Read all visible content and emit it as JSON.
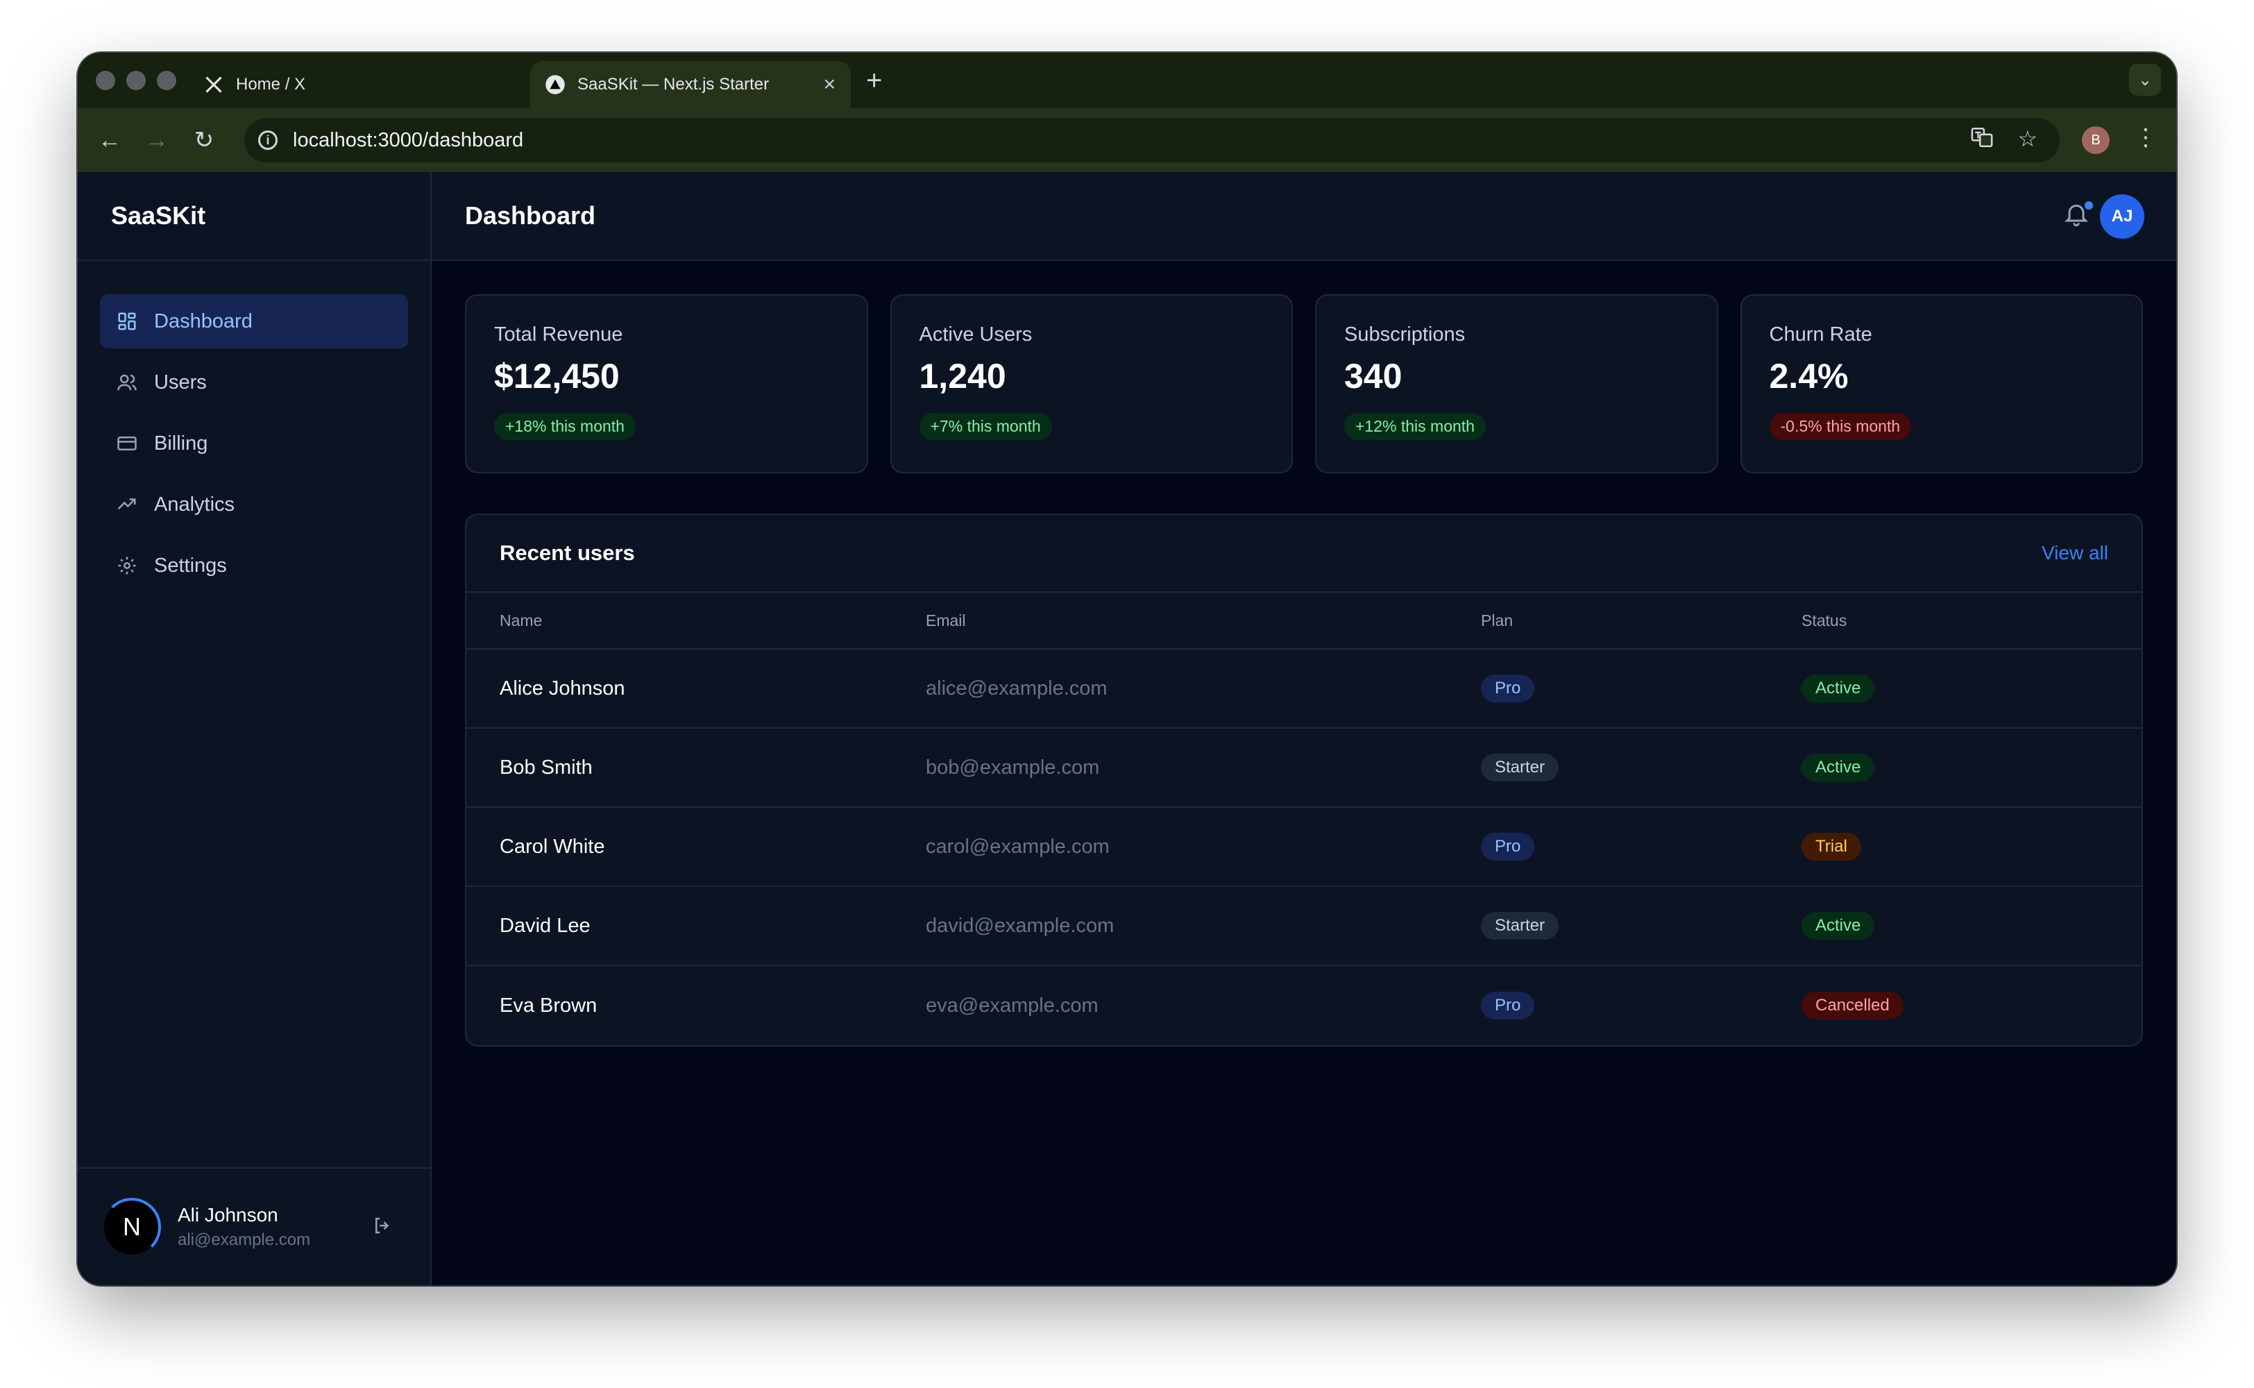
{
  "browser": {
    "tabs": [
      {
        "title": "Home / X",
        "favicon": "x-logo-icon",
        "active": false
      },
      {
        "title": "SaaSKit — Next.js Starter",
        "favicon": "triangle-logo-icon",
        "active": true
      }
    ],
    "url": "localhost:3000/dashboard",
    "profile_initial": "B"
  },
  "sidebar": {
    "brand": "SaaSKit",
    "items": [
      {
        "label": "Dashboard",
        "icon": "dashboard-grid-icon",
        "active": true
      },
      {
        "label": "Users",
        "icon": "users-icon",
        "active": false
      },
      {
        "label": "Billing",
        "icon": "credit-card-icon",
        "active": false
      },
      {
        "label": "Analytics",
        "icon": "trending-up-icon",
        "active": false
      },
      {
        "label": "Settings",
        "icon": "gear-icon",
        "active": false
      }
    ],
    "user": {
      "logo_letter": "N",
      "name": "Ali Johnson",
      "email": "ali@example.com"
    }
  },
  "header": {
    "title": "Dashboard",
    "avatar_initials": "AJ"
  },
  "stats": [
    {
      "label": "Total Revenue",
      "value": "$12,450",
      "change": "+18% this month",
      "trend": "positive"
    },
    {
      "label": "Active Users",
      "value": "1,240",
      "change": "+7% this month",
      "trend": "positive"
    },
    {
      "label": "Subscriptions",
      "value": "340",
      "change": "+12% this month",
      "trend": "positive"
    },
    {
      "label": "Churn Rate",
      "value": "2.4%",
      "change": "-0.5% this month",
      "trend": "negative"
    }
  ],
  "recent_users": {
    "title": "Recent users",
    "view_all": "View all",
    "columns": [
      "Name",
      "Email",
      "Plan",
      "Status"
    ],
    "rows": [
      {
        "name": "Alice Johnson",
        "email": "alice@example.com",
        "plan": "Pro",
        "status": "Active"
      },
      {
        "name": "Bob Smith",
        "email": "bob@example.com",
        "plan": "Starter",
        "status": "Active"
      },
      {
        "name": "Carol White",
        "email": "carol@example.com",
        "plan": "Pro",
        "status": "Trial"
      },
      {
        "name": "David Lee",
        "email": "david@example.com",
        "plan": "Starter",
        "status": "Active"
      },
      {
        "name": "Eva Brown",
        "email": "eva@example.com",
        "plan": "Pro",
        "status": "Cancelled"
      }
    ]
  },
  "colors": {
    "accent": "#3b82f6",
    "background": "#020617",
    "surface": "#0c1424",
    "border": "#1e293b"
  }
}
